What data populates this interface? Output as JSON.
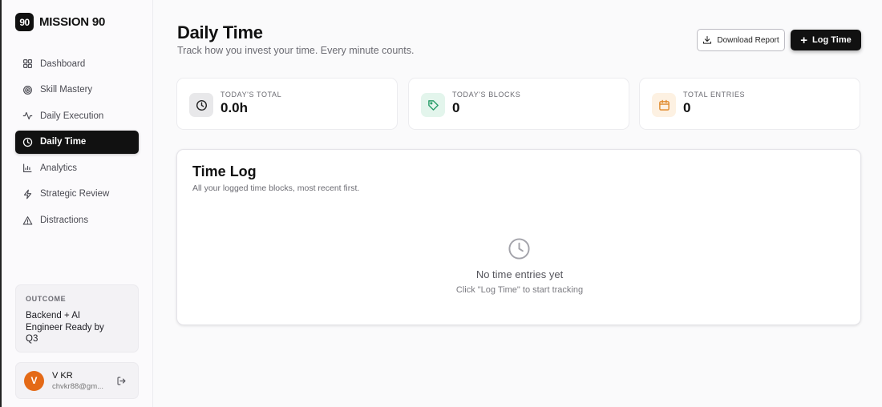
{
  "brand": {
    "logo_text": "90",
    "name": "MISSION 90"
  },
  "sidebar": {
    "items": [
      {
        "label": "Dashboard",
        "icon": "grid-icon"
      },
      {
        "label": "Skill Mastery",
        "icon": "target-icon"
      },
      {
        "label": "Daily Execution",
        "icon": "activity-icon"
      },
      {
        "label": "Daily Time",
        "icon": "clock-icon",
        "active": true
      },
      {
        "label": "Analytics",
        "icon": "bar-chart-icon"
      },
      {
        "label": "Strategic Review",
        "icon": "lightning-icon"
      },
      {
        "label": "Distractions",
        "icon": "warning-triangle-icon"
      }
    ],
    "outcome": {
      "label": "OUTCOME",
      "text": "Backend + AI Engineer Ready by Q3"
    },
    "user": {
      "initial": "V",
      "name": "V KR",
      "email": "chvkr88@gm..."
    }
  },
  "header": {
    "title": "Daily Time",
    "subtitle": "Track how you invest your time. Every minute counts.",
    "download_label": "Download Report",
    "log_time_label": "Log Time"
  },
  "stats": [
    {
      "label": "TODAY'S TOTAL",
      "value": "0.0h",
      "icon": "clock-icon",
      "color": "#e8e8ea"
    },
    {
      "label": "TODAY'S BLOCKS",
      "value": "0",
      "icon": "tag-icon",
      "color": "#e3f5ec"
    },
    {
      "label": "TOTAL ENTRIES",
      "value": "0",
      "icon": "calendar-icon",
      "color": "#fdf1e2"
    }
  ],
  "time_log": {
    "title": "Time Log",
    "subtitle": "All your logged time blocks, most recent first.",
    "empty_title": "No time entries yet",
    "empty_hint": "Click \"Log Time\" to start tracking"
  },
  "colors": {
    "accent": "#111111",
    "avatar": "#e46a17",
    "tag_green": "#2a9d6a",
    "calendar_orange": "#e08a2c"
  }
}
